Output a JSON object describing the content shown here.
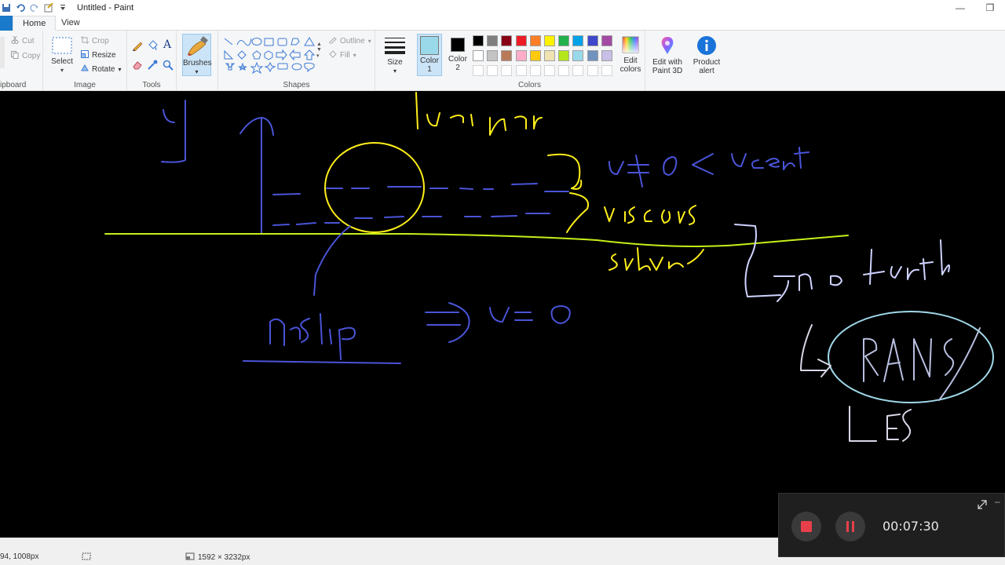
{
  "window": {
    "title": "Untitled - Paint",
    "minimize_glyph": "—",
    "restore_glyph": "❐"
  },
  "tabs": [
    {
      "label": "Home",
      "active": true
    },
    {
      "label": "View",
      "active": false
    }
  ],
  "ribbon": {
    "clipboard": {
      "label": "ipboard",
      "cut": "Cut",
      "copy": "Copy"
    },
    "image": {
      "label": "Image",
      "select": "Select",
      "crop": "Crop",
      "resize": "Resize",
      "rotate": "Rotate"
    },
    "tools": {
      "label": "Tools"
    },
    "brushes": {
      "label": "Brushes"
    },
    "shapes": {
      "label": "Shapes",
      "outline": "Outline",
      "fill": "Fill"
    },
    "size": {
      "label": "Size"
    },
    "colors": {
      "label": "Colors",
      "color1": "Color",
      "color1_num": "1",
      "color2": "Color",
      "color2_num": "2",
      "color1_value": "#99d9ea",
      "color2_value": "#000000",
      "edit_colors": "Edit",
      "edit_colors_2": "colors",
      "palette_row1": [
        "#000000",
        "#7f7f7f",
        "#880015",
        "#ed1c24",
        "#ff7f27",
        "#fff200",
        "#22b14c",
        "#00a2e8",
        "#3f48cc",
        "#a349a4"
      ],
      "palette_row2": [
        "#ffffff",
        "#c3c3c3",
        "#b97a57",
        "#ffaec9",
        "#ffc90e",
        "#efe4b0",
        "#b5e61d",
        "#99d9ea",
        "#7092be",
        "#c8bfe7"
      ]
    },
    "paint3d": {
      "label1": "Edit with",
      "label2": "Paint 3D"
    },
    "product_alert": {
      "label1": "Product",
      "label2": "alert"
    }
  },
  "statusbar": {
    "cursor_pos": "94, 1008px",
    "image_size": "1592 × 3232px"
  },
  "recorder": {
    "elapsed": "00:07:30",
    "stop_color": "#e8404a",
    "pause_color": "#e8404a"
  }
}
